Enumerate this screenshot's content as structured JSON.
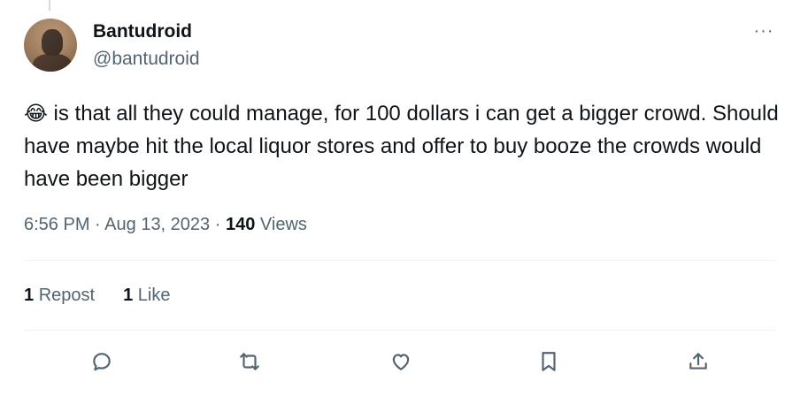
{
  "author": {
    "display_name": "Bantudroid",
    "handle": "@bantudroid"
  },
  "tweet": {
    "emoji": "😂",
    "text": " is that all they could manage, for 100 dollars i can get a bigger crowd. Should have maybe hit the local liquor stores and offer to buy booze the crowds would have been bigger"
  },
  "meta": {
    "time": "6:56 PM",
    "separator": "·",
    "date": "Aug 13, 2023",
    "views_count": "140",
    "views_label": "Views"
  },
  "stats": {
    "reposts_count": "1",
    "reposts_label": "Repost",
    "likes_count": "1",
    "likes_label": "Like"
  },
  "more_label": "···",
  "icons": [
    "reply-icon",
    "repost-icon",
    "like-icon",
    "bookmark-icon",
    "share-icon"
  ]
}
